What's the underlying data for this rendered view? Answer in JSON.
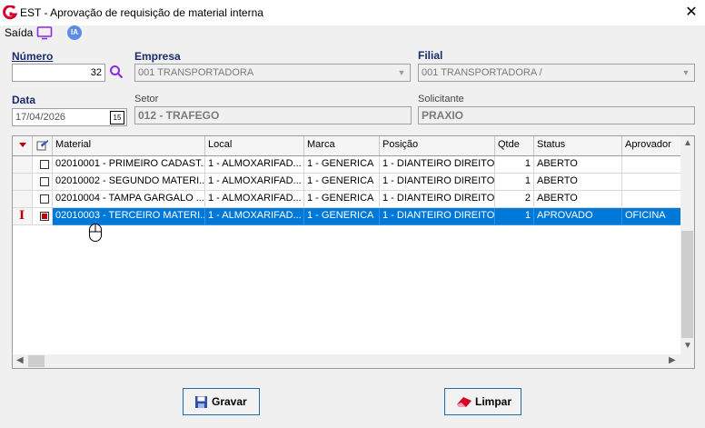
{
  "window": {
    "title": "EST - Aprovação de requisição de material interna",
    "close": "✕"
  },
  "menu": {
    "saida": "Saída",
    "ia": "IA"
  },
  "form": {
    "numero_label": "Número",
    "numero_value": "32",
    "empresa_label": "Empresa",
    "empresa_value": "001 TRANSPORTADORA",
    "filial_label": "Filial",
    "filial_value": "001 TRANSPORTADORA /",
    "data_label": "Data",
    "data_value": "17/04/2026",
    "calendar_icon_text": "15",
    "setor_label": "Setor",
    "setor_value": "012 - TRAFEGO",
    "solicitante_label": "Solicitante",
    "solicitante_value": "PRAXIO"
  },
  "grid": {
    "columns": [
      "Material",
      "Local",
      "Marca",
      "Posição",
      "Qtde",
      "Status",
      "Aprovador"
    ],
    "rows": [
      {
        "checked": false,
        "selected": false,
        "material": "02010001 - PRIMEIRO CADAST...",
        "local": "1 - ALMOXARIFAD...",
        "marca": "1 - GENERICA",
        "posicao": "1 - DIANTEIRO DIREITO",
        "qtde": "1",
        "status": "ABERTO",
        "aprovador": ""
      },
      {
        "checked": false,
        "selected": false,
        "material": "02010002 - SEGUNDO MATERI...",
        "local": "1 - ALMOXARIFAD...",
        "marca": "1 - GENERICA",
        "posicao": "1 - DIANTEIRO DIREITO",
        "qtde": "1",
        "status": "ABERTO",
        "aprovador": ""
      },
      {
        "checked": false,
        "selected": false,
        "material": "02010004 - TAMPA GARGALO ...",
        "local": "1 - ALMOXARIFAD...",
        "marca": "1 - GENERICA",
        "posicao": "1 - DIANTEIRO DIREITO",
        "qtde": "2",
        "status": "ABERTO",
        "aprovador": ""
      },
      {
        "checked": true,
        "selected": true,
        "material": "02010003 - TERCEIRO MATERI...",
        "local": "1 - ALMOXARIFAD...",
        "marca": "1 - GENERICA",
        "posicao": "1 - DIANTEIRO DIREITO",
        "qtde": "1",
        "status": "APROVADO",
        "aprovador": "OFICINA"
      }
    ]
  },
  "buttons": {
    "gravar": "Gravar",
    "limpar": "Limpar"
  },
  "colors": {
    "label_blue": "#1b2b6b",
    "selection": "#0078d7",
    "button_border": "#1c6ea4"
  }
}
